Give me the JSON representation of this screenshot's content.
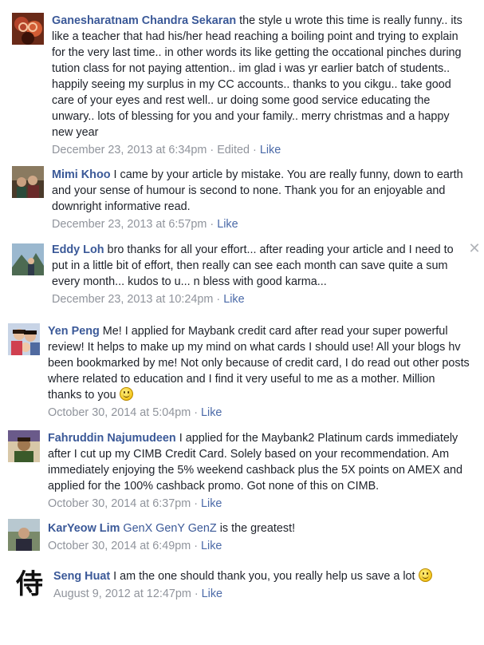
{
  "comments": [
    {
      "author": "Ganesharatnam Chandra Sekaran",
      "text": " the style u wrote this time is really funny.. its like a teacher that had his/her head reaching a boiling point and trying to explain for the very last time.. in other words its like getting the occational pinches during tution class for not paying attention.. im glad i was yr earlier batch of students.. happily seeing my surplus in my CC accounts.. thanks to you cikgu.. take good care of your eyes and rest well.. ur doing some good service educating the unwary.. lots of blessing for you and your family.. merry christmas and a happy new year",
      "timestamp": "December 23, 2013 at 6:34pm",
      "edited": "Edited",
      "like": "Like"
    },
    {
      "author": "Mimi Khoo",
      "text": " I came by your article by mistake. You are really funny, down to earth and your sense of humour is second to none. Thank you for an enjoyable and downright informative read.",
      "timestamp": "December 23, 2013 at 6:57pm",
      "like": "Like"
    },
    {
      "author": "Eddy Loh",
      "text": " bro thanks for all your effort... after reading your article and I need to put in a little bit of effort, then really can see each month can save quite a sum every month... kudos to u... n bless with good karma...",
      "timestamp": "December 23, 2013 at 10:24pm",
      "like": "Like"
    },
    {
      "author": "Yen Peng",
      "text": " Me! I applied for Maybank credit card after read your super powerful review! It helps to make up my mind on what cards I should use! All your blogs hv been bookmarked by me! Not only because of credit card, I do read out other posts where related to education and I find it very useful to me as a mother. Million thanks to you",
      "timestamp": "October 30, 2014 at 5:04pm",
      "like": "Like"
    },
    {
      "author": "Fahruddin Najumudeen",
      "text": " I applied for the Maybank2 Platinum cards immediately after I cut up my CIMB Credit Card. Solely based on your recommendation. Am immediately enjoying the 5% weekend cashback plus the 5X points on AMEX and applied for the 100% cashback promo. Got none of this on CIMB.",
      "timestamp": "October 30, 2014 at 6:37pm",
      "like": "Like"
    },
    {
      "author": "KarYeow Lim",
      "mention": "GenX GenY GenZ",
      "text": " is the greatest!",
      "timestamp": "October 30, 2014 at 6:49pm",
      "like": "Like"
    },
    {
      "author": "Seng Huat",
      "text": " I am the one should thank you, you really help us save a lot",
      "timestamp": "August 9, 2012 at 12:47pm",
      "like": "Like",
      "avatar_glyph": "侍"
    }
  ],
  "separator": "·",
  "close_glyph": "✕",
  "colors": {
    "link": "#3b5998",
    "meta": "#90949c",
    "like": "#4b6aa8"
  }
}
